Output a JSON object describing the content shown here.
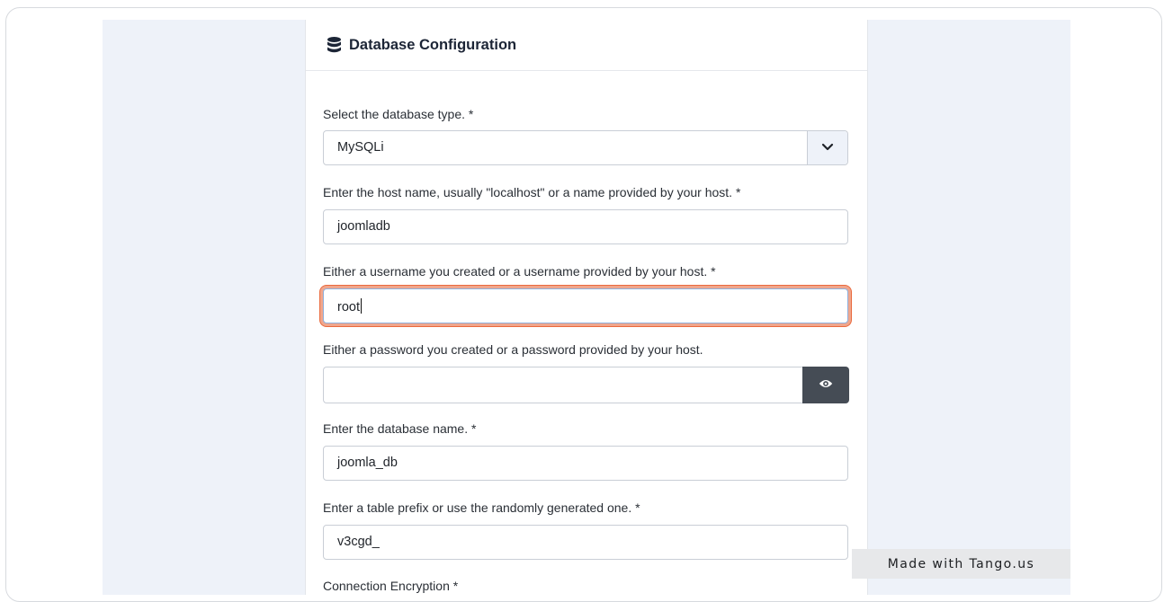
{
  "header": {
    "title": "Database Configuration",
    "icon": "database-icon"
  },
  "fields": {
    "db_type": {
      "label": "Select the database type. *",
      "value": "MySQLi"
    },
    "host": {
      "label": "Enter the host name, usually \"localhost\" or a name provided by your host. *",
      "value": "joomladb"
    },
    "username": {
      "label": "Either a username you created or a username provided by your host. *",
      "value": "root"
    },
    "password": {
      "label": "Either a password you created or a password provided by your host.",
      "value": ""
    },
    "db_name": {
      "label": "Enter the database name. *",
      "value": "joomla_db"
    },
    "prefix": {
      "label": "Enter a table prefix or use the randomly generated one. *",
      "value": "v3cgd_"
    },
    "encryption": {
      "label": "Connection Encryption *"
    }
  },
  "badge": {
    "text": "Made with Tango.us"
  },
  "colors": {
    "focus_ring": "#ea6a3e",
    "page_background": "#eef2f9",
    "eye_button": "#454c55"
  }
}
